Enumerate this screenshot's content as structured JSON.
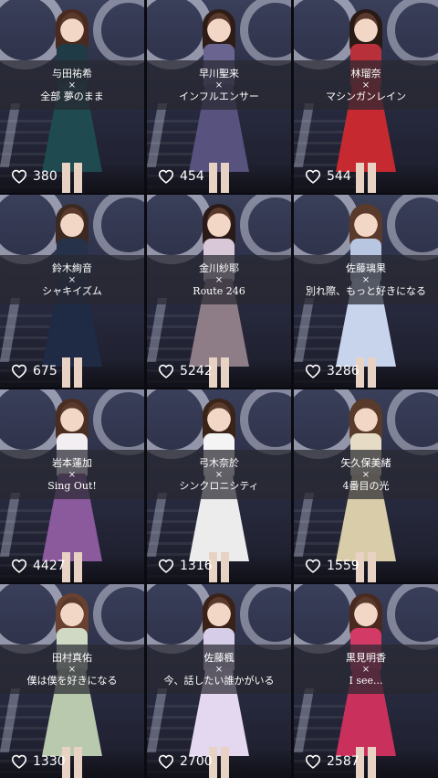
{
  "tiles": [
    {
      "name": "与田祐希",
      "song": "全部 夢のまま",
      "likes": "380",
      "colors": {
        "torso": "#1f3b45",
        "skirt": "#1e4a50",
        "hair": "#4a2a1e"
      }
    },
    {
      "name": "早川聖来",
      "song": "インフルエンサー",
      "likes": "454",
      "colors": {
        "torso": "#6a6490",
        "skirt": "#57537e",
        "hair": "#2e1c16"
      }
    },
    {
      "name": "林瑠奈",
      "song": "マシンガンレイン",
      "likes": "544",
      "colors": {
        "torso": "#b8303a",
        "skirt": "#c62a30",
        "hair": "#2a1a16"
      }
    },
    {
      "name": "鈴木絢音",
      "song": "シャキイズム",
      "likes": "675",
      "colors": {
        "torso": "#25324a",
        "skirt": "#1f2a44",
        "hair": "#3c2a22"
      }
    },
    {
      "name": "金川紗耶",
      "song": "Route 246",
      "likes": "5242",
      "colors": {
        "torso": "#d8c8d8",
        "skirt": "#8e7c86",
        "hair": "#2a1a18"
      }
    },
    {
      "name": "佐藤璃果",
      "song": "別れ際、もっと好きになる",
      "likes": "3286",
      "colors": {
        "torso": "#b9c6e2",
        "skirt": "#c8d4ec",
        "hair": "#5a3a2a"
      }
    },
    {
      "name": "岩本蓮加",
      "song": "Sing Out!",
      "likes": "4427",
      "colors": {
        "torso": "#f2eef2",
        "skirt": "#8a5a9c",
        "hair": "#4a2e22"
      }
    },
    {
      "name": "弓木奈於",
      "song": "シンクロニシティ",
      "likes": "1316",
      "colors": {
        "torso": "#f4f4f4",
        "skirt": "#ececec",
        "hair": "#3a2418"
      }
    },
    {
      "name": "矢久保美緒",
      "song": "4番目の光",
      "likes": "1559",
      "colors": {
        "torso": "#e6dcc6",
        "skirt": "#d9cca8",
        "hair": "#5a3a28"
      }
    },
    {
      "name": "田村真佑",
      "song": "僕は僕を好きになる",
      "likes": "1330",
      "colors": {
        "torso": "#cfd9c4",
        "skirt": "#b8c9ae",
        "hair": "#6a4030"
      }
    },
    {
      "name": "佐藤楓",
      "song": "今、話したい誰かがいる",
      "likes": "2700",
      "colors": {
        "torso": "#d6cde8",
        "skirt": "#e4d8f0",
        "hair": "#3a2218"
      }
    },
    {
      "name": "黒見明香",
      "song": "I see...",
      "likes": "2587",
      "colors": {
        "torso": "#d33a66",
        "skirt": "#c9305c",
        "hair": "#4a2a1e"
      }
    }
  ],
  "separator": "×",
  "icons": {
    "like": "heart-outline-icon"
  }
}
